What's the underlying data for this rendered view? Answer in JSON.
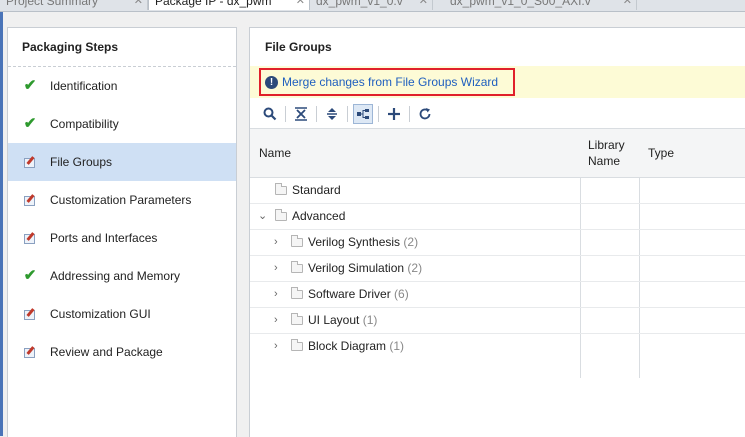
{
  "tabs": [
    {
      "label": "Project Summary",
      "active": false
    },
    {
      "label": "Package IP - dx_pwm",
      "active": true
    },
    {
      "label": "dx_pwm_v1_0.v",
      "active": false
    },
    {
      "label": "dx_pwm_v1_0_S00_AXI.v",
      "active": false
    }
  ],
  "left_panel": {
    "title": "Packaging Steps",
    "steps": [
      {
        "label": "Identification",
        "status": "check"
      },
      {
        "label": "Compatibility",
        "status": "check"
      },
      {
        "label": "File Groups",
        "status": "edit",
        "selected": true
      },
      {
        "label": "Customization Parameters",
        "status": "edit"
      },
      {
        "label": "Ports and Interfaces",
        "status": "edit"
      },
      {
        "label": "Addressing and Memory",
        "status": "check"
      },
      {
        "label": "Customization GUI",
        "status": "edit"
      },
      {
        "label": "Review and Package",
        "status": "edit"
      }
    ]
  },
  "right_panel": {
    "title": "File Groups",
    "banner": {
      "icon": "info-icon",
      "link_text": "Merge changes from File Groups Wizard"
    },
    "toolbar": [
      {
        "name": "search-icon",
        "glyph": "🔍"
      },
      {
        "name": "collapse-all-icon",
        "glyph": "⇊"
      },
      {
        "name": "expand-all-icon",
        "glyph": "⇕"
      },
      {
        "name": "hierarchy-icon",
        "glyph": "⊞",
        "active": true
      },
      {
        "name": "add-icon",
        "glyph": "+"
      },
      {
        "name": "refresh-icon",
        "glyph": "↻"
      }
    ],
    "columns": {
      "name": "Name",
      "library_name": "Library Name",
      "type": "Type"
    },
    "rows": [
      {
        "label": "Standard",
        "count": "",
        "level": 0,
        "chevron": ""
      },
      {
        "label": "Advanced",
        "count": "",
        "level": 0,
        "chevron": "down"
      },
      {
        "label": "Verilog Synthesis",
        "count": "(2)",
        "level": 1,
        "chevron": "right"
      },
      {
        "label": "Verilog Simulation",
        "count": "(2)",
        "level": 1,
        "chevron": "right"
      },
      {
        "label": "Software Driver",
        "count": "(6)",
        "level": 1,
        "chevron": "right"
      },
      {
        "label": "UI Layout",
        "count": "(1)",
        "level": 1,
        "chevron": "right"
      },
      {
        "label": "Block Diagram",
        "count": "(1)",
        "level": 1,
        "chevron": "right"
      }
    ]
  }
}
